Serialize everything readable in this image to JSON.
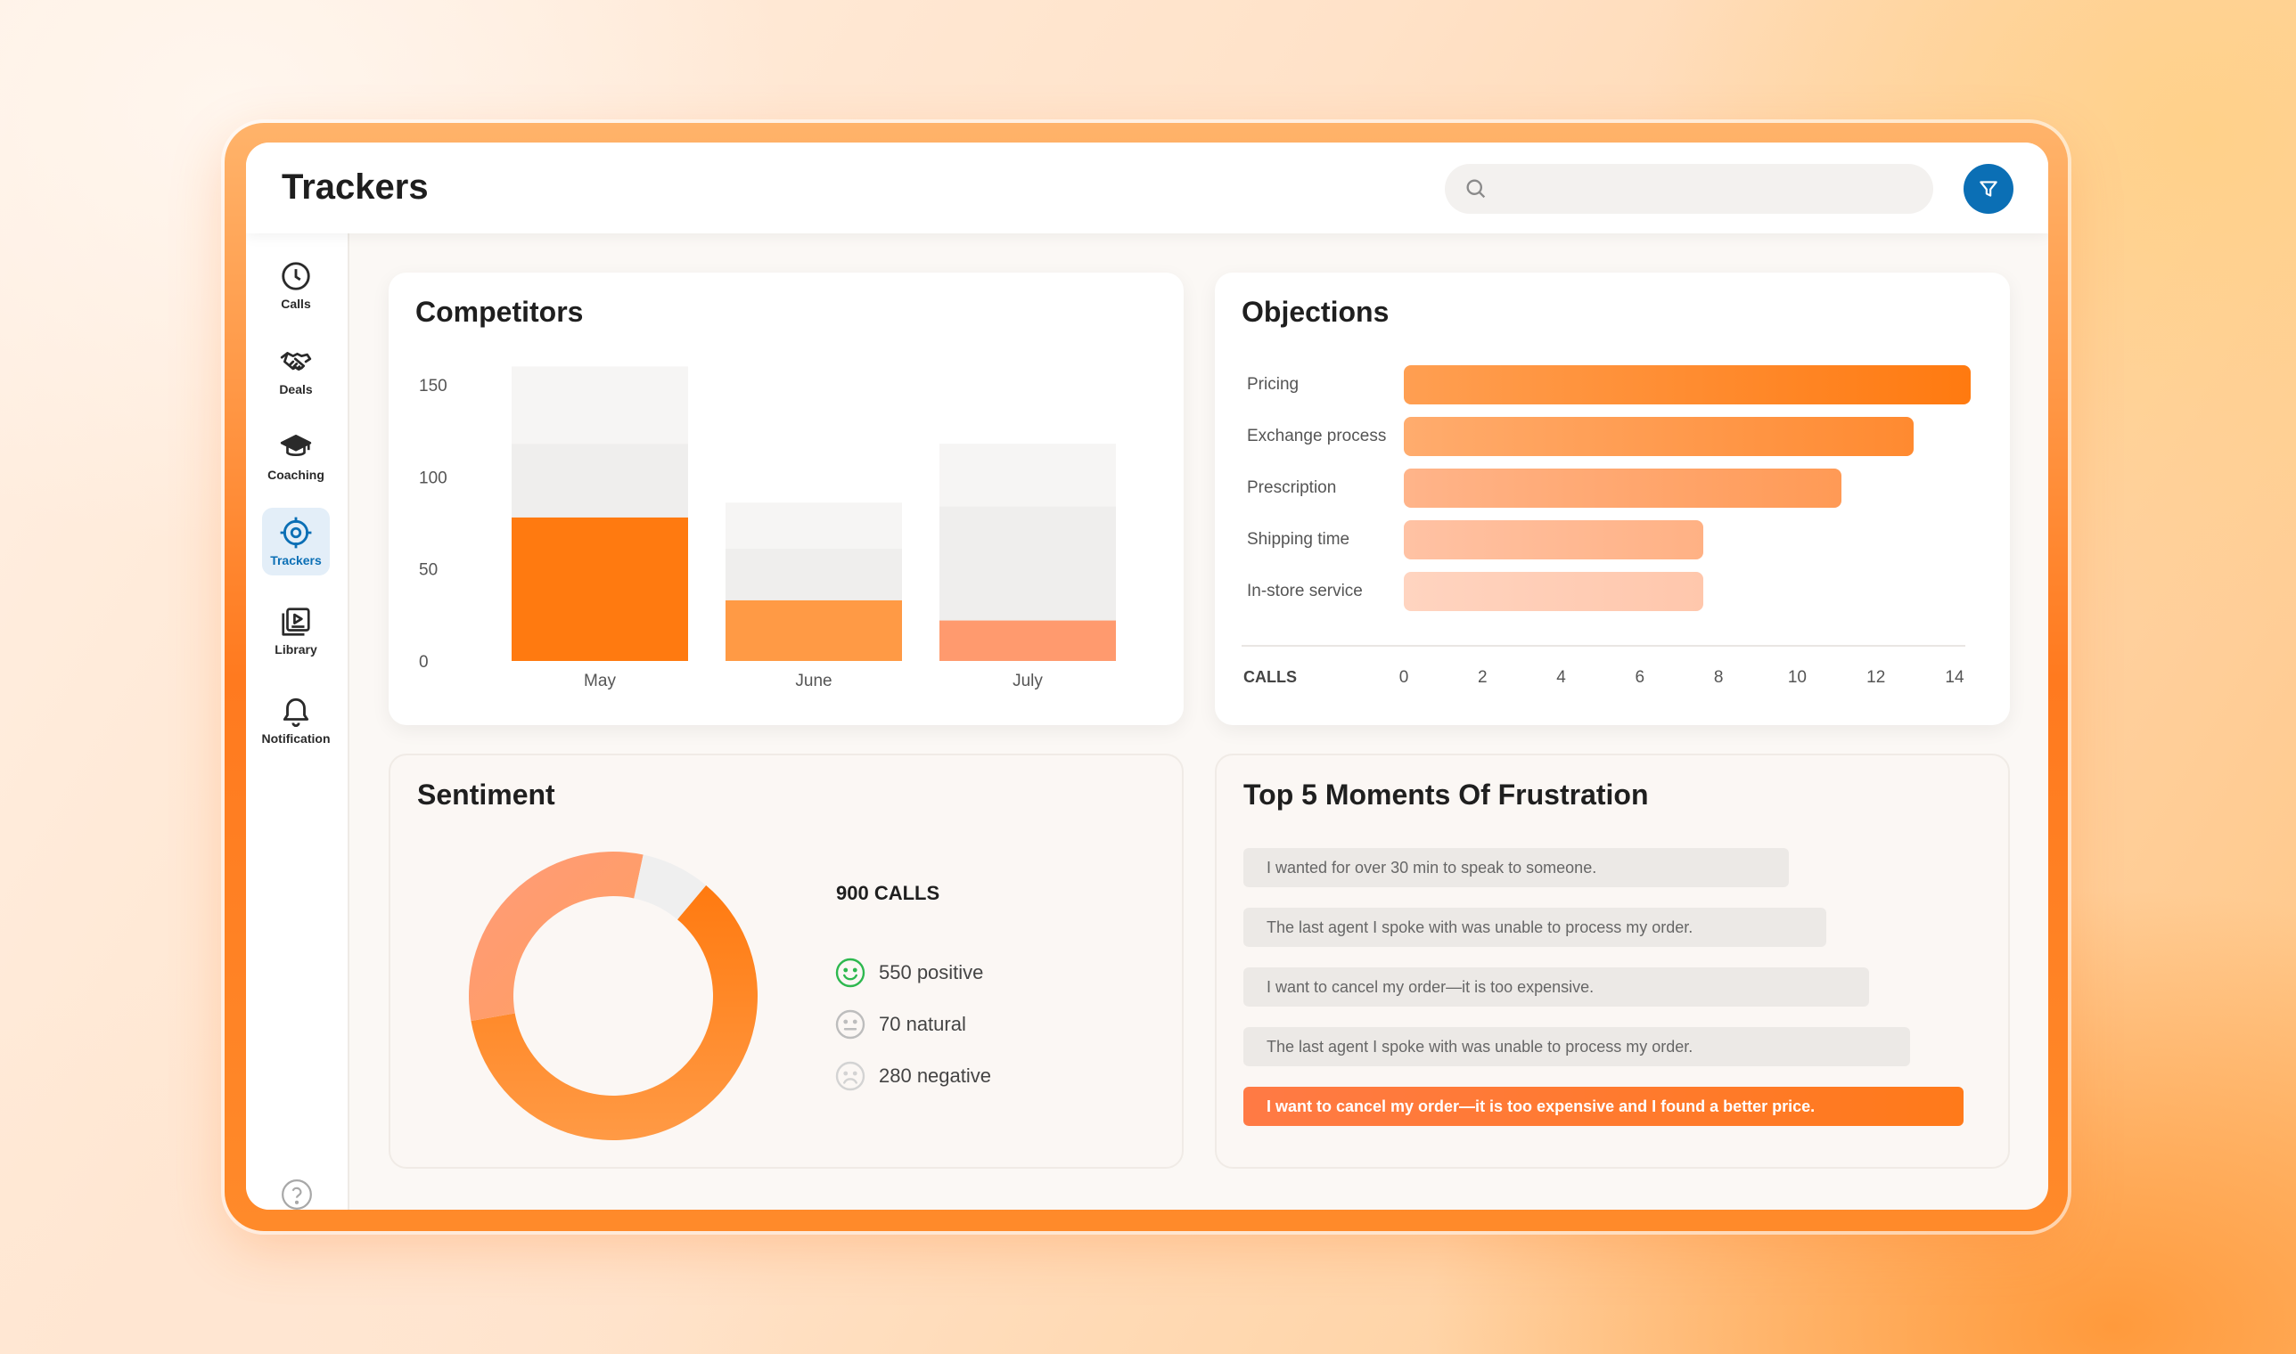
{
  "header": {
    "title": "Trackers",
    "search_placeholder": ""
  },
  "sidebar": {
    "items": [
      {
        "label": "Calls",
        "icon": "clock-icon"
      },
      {
        "label": "Deals",
        "icon": "handshake-icon"
      },
      {
        "label": "Coaching",
        "icon": "graduation-cap-icon"
      },
      {
        "label": "Trackers",
        "icon": "target-icon",
        "active": true
      },
      {
        "label": "Library",
        "icon": "library-icon"
      },
      {
        "label": "Notification",
        "icon": "bell-icon"
      }
    ],
    "help_icon": "question-circle-icon"
  },
  "colors": {
    "accent": "#ff7a1a",
    "filter_button": "#0b6fb5",
    "active_nav_bg": "#e3eef8"
  },
  "competitors": {
    "title": "Competitors",
    "chart_data": {
      "type": "bar",
      "stacked": true,
      "categories": [
        "May",
        "June",
        "July"
      ],
      "ylim": [
        0,
        150
      ],
      "yticks": [
        0,
        50,
        100,
        150
      ],
      "series": [
        {
          "values": [
            78,
            33,
            22
          ],
          "colors": [
            "#ff7a10",
            "#ff9a45",
            "#ff9a6e"
          ]
        },
        {
          "values": [
            40,
            28,
            62
          ],
          "colors": [
            "#efeeed",
            "#efeeed",
            "#efeeed"
          ]
        },
        {
          "values": [
            42,
            25,
            34
          ],
          "colors": [
            "#f6f5f4",
            "#f6f5f4",
            "#f6f5f4"
          ]
        }
      ]
    }
  },
  "objections": {
    "title": "Objections",
    "axis_label": "CALLS",
    "chart_data": {
      "type": "bar",
      "orientation": "horizontal",
      "categories": [
        "Pricing",
        "Exchange process",
        "Prescription",
        "Shipping time",
        "In-store service"
      ],
      "values": [
        14.1,
        12.6,
        10.8,
        7.4,
        7.4
      ],
      "xlim": [
        0,
        14
      ],
      "xticks": [
        0,
        2,
        4,
        6,
        8,
        10,
        12,
        14
      ],
      "colors": [
        [
          "#ff9f52",
          "#ff7a10"
        ],
        [
          "#ffac6e",
          "#ff8a30"
        ],
        [
          "#ffb48a",
          "#ff9a55"
        ],
        [
          "#ffc2a4",
          "#ffb184"
        ],
        [
          "#ffd4c0",
          "#ffc7ac"
        ]
      ]
    }
  },
  "sentiment": {
    "title": "Sentiment",
    "total_label": "900 CALLS",
    "chart_data": {
      "type": "pie",
      "donut": true,
      "slices": [
        {
          "label": "550 positive",
          "value": 550,
          "icon": "smile-icon",
          "icon_color": "#2eb84f"
        },
        {
          "label": "70 natural",
          "value": 70,
          "icon": "neutral-face-icon",
          "icon_color": "#bdbdbd"
        },
        {
          "label": "280 negative",
          "value": 280,
          "icon": "sad-face-icon",
          "icon_color": "#d3d3d3"
        }
      ]
    }
  },
  "frustration": {
    "title": "Top 5 Moments Of Frustration",
    "items": [
      "I wanted for over 30 min to speak to someone.",
      "The last agent I spoke with was unable to process my order.",
      "I want to cancel my order—it is too expensive.",
      "The last agent I spoke with was unable to process my order.",
      "I want to cancel my order—it is too expensive and I found a better price."
    ]
  }
}
